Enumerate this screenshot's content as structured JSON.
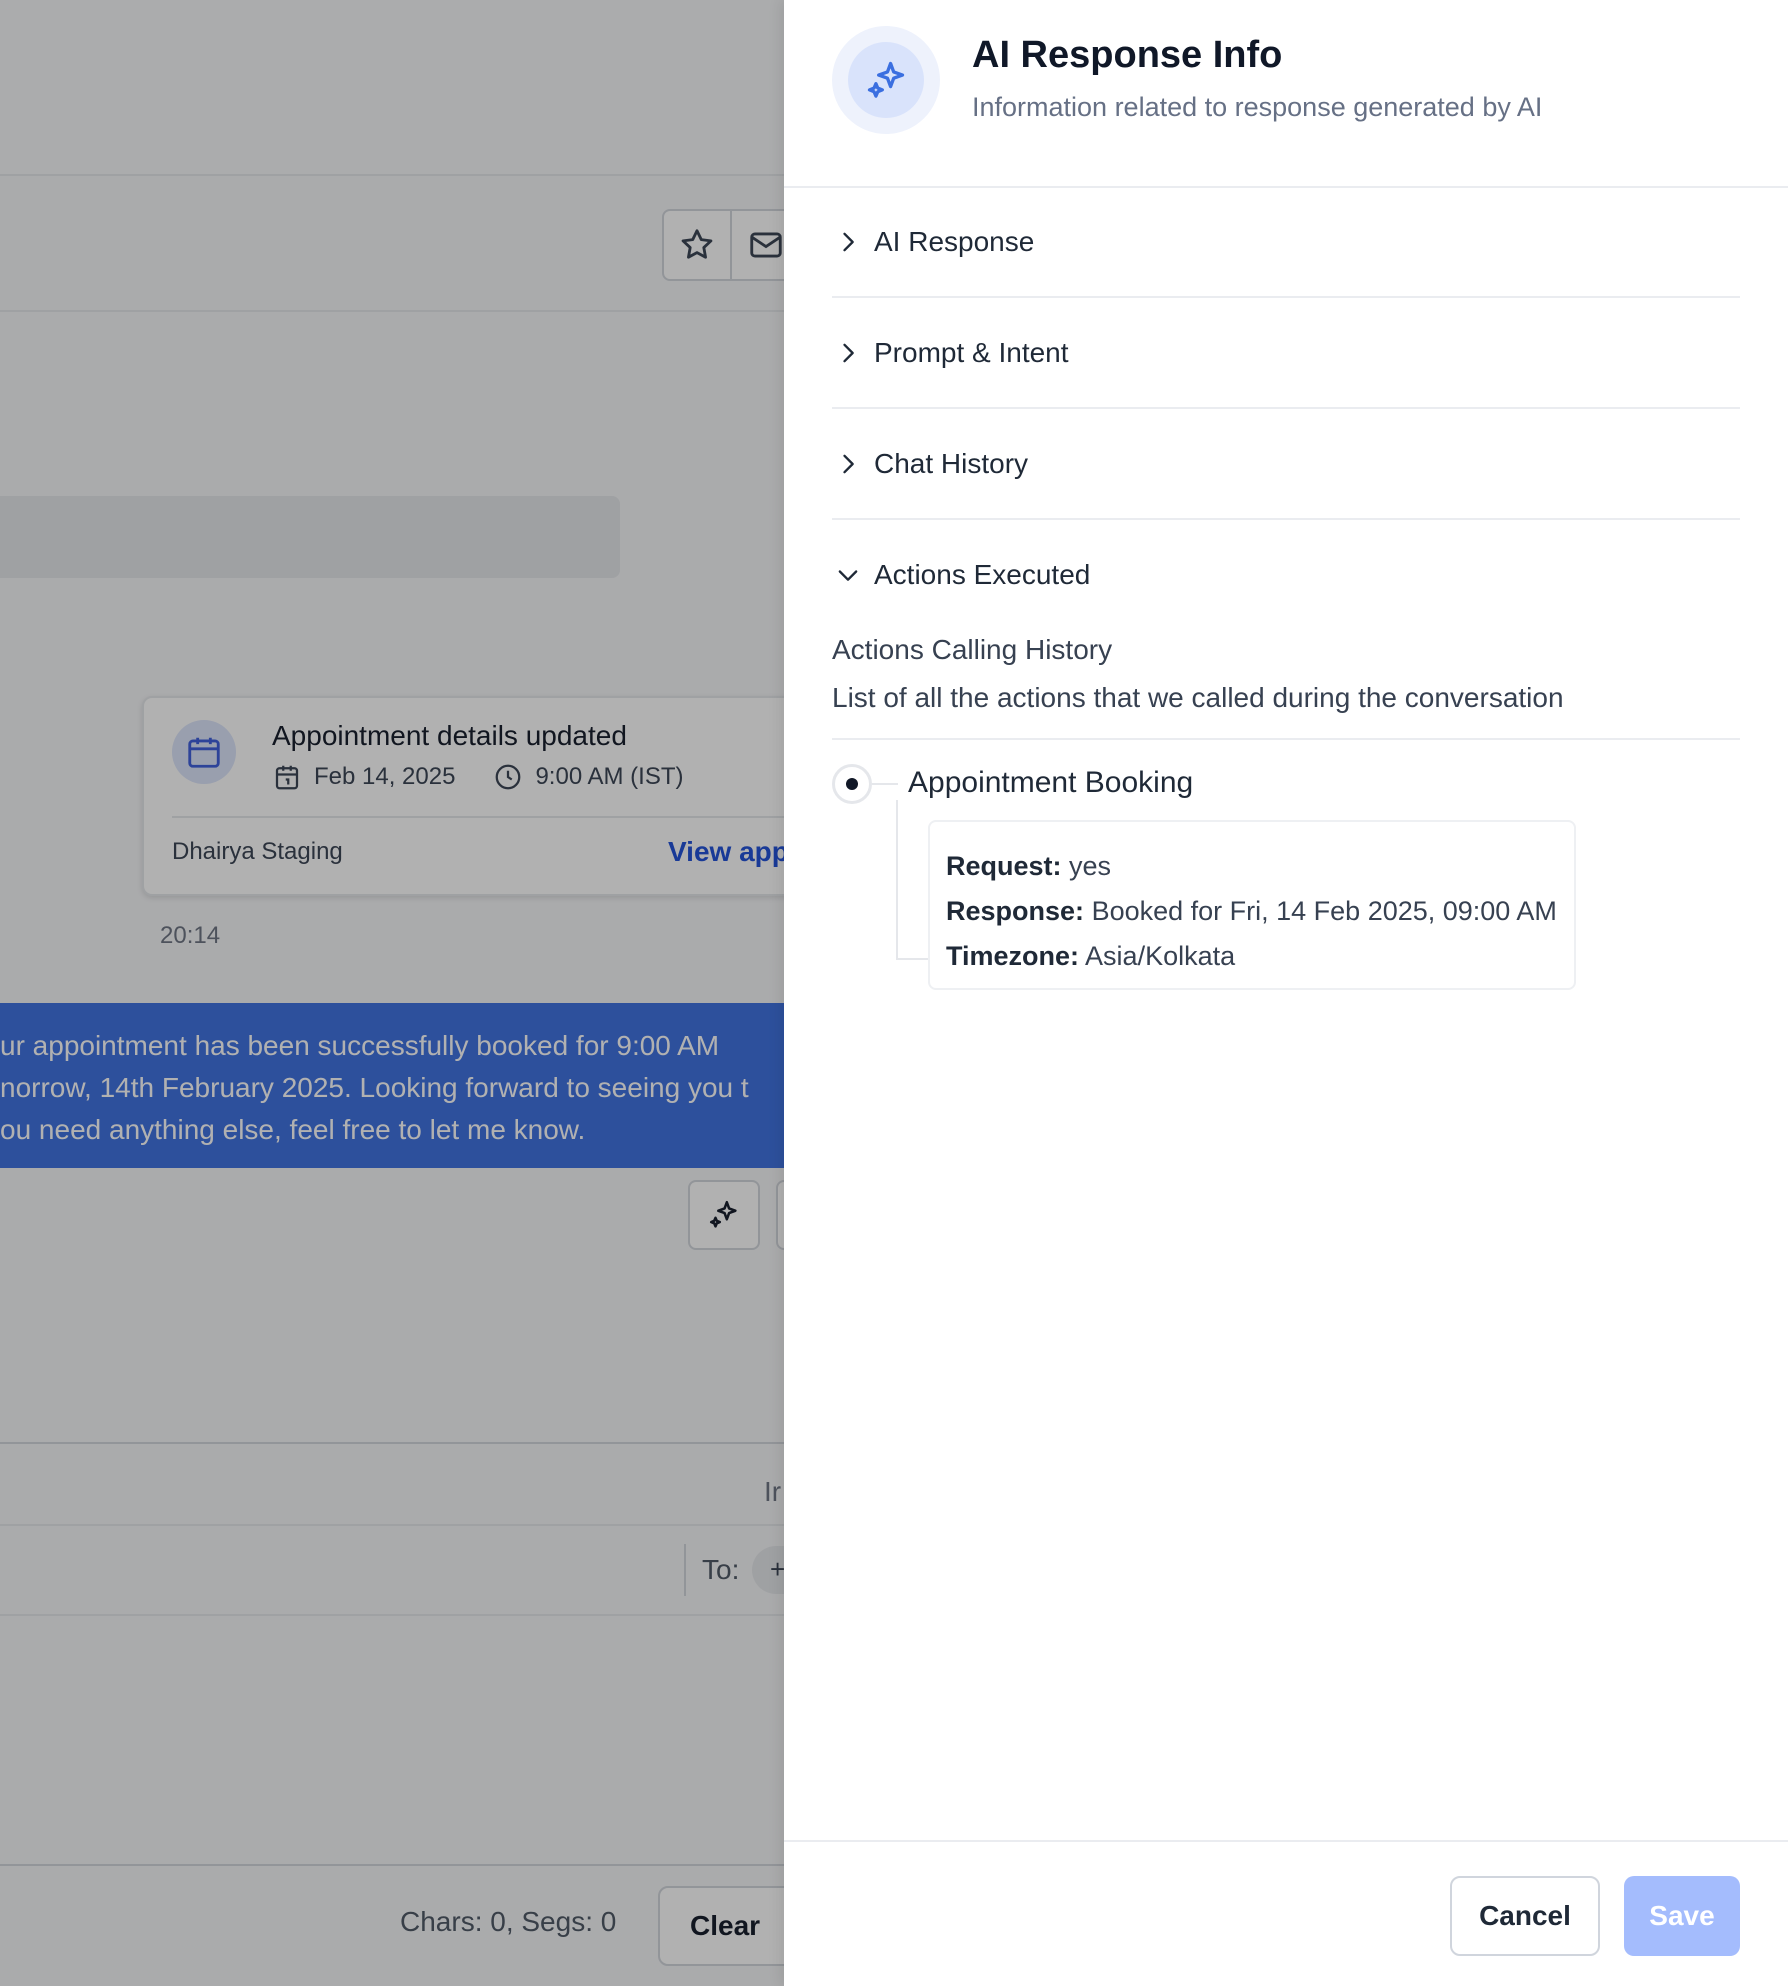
{
  "background": {
    "appointment_card": {
      "title": "Appointment details updated",
      "date": "Feb 14, 2025",
      "time": "9:00 AM (IST)",
      "location": "Dhairya Staging",
      "link": "View app"
    },
    "timestamp": "20:14",
    "message_lines": [
      "ur appointment has been successfully booked for 9:00 AM",
      "norrow, 14th February 2025. Looking forward to seeing you t",
      "ou need anything else, feel free to let me know."
    ],
    "compose": {
      "tab_partial": "Ir",
      "to_label": "To:",
      "to_chip": "+",
      "counter": "Chars: 0, Segs: 0",
      "clear_label": "Clear"
    }
  },
  "drawer": {
    "title": "AI Response Info",
    "subtitle": "Information related to response generated by AI",
    "sections": [
      {
        "label": "AI Response",
        "expanded": false
      },
      {
        "label": "Prompt & Intent",
        "expanded": false
      },
      {
        "label": "Chat History",
        "expanded": false
      },
      {
        "label": "Actions Executed",
        "expanded": true
      }
    ],
    "actions": {
      "title": "Actions Calling History",
      "description": "List of all the actions that we called during the conversation",
      "items": [
        {
          "name": "Appointment Booking",
          "fields": [
            {
              "key": "Request:",
              "value": "yes"
            },
            {
              "key": "Response:",
              "value": "Booked for Fri, 14 Feb 2025, 09:00 AM"
            },
            {
              "key": "Timezone:",
              "value": "Asia/Kolkata"
            }
          ]
        }
      ]
    },
    "footer": {
      "cancel_label": "Cancel",
      "save_label": "Save"
    }
  },
  "colors": {
    "accent": "#3b6fe0",
    "save_disabled": "#a4bcfd",
    "link": "#1d4ed8"
  },
  "icons": {
    "header": "sparkles-icon",
    "collapsed": "chevron-right-icon",
    "expanded": "chevron-down-icon"
  }
}
